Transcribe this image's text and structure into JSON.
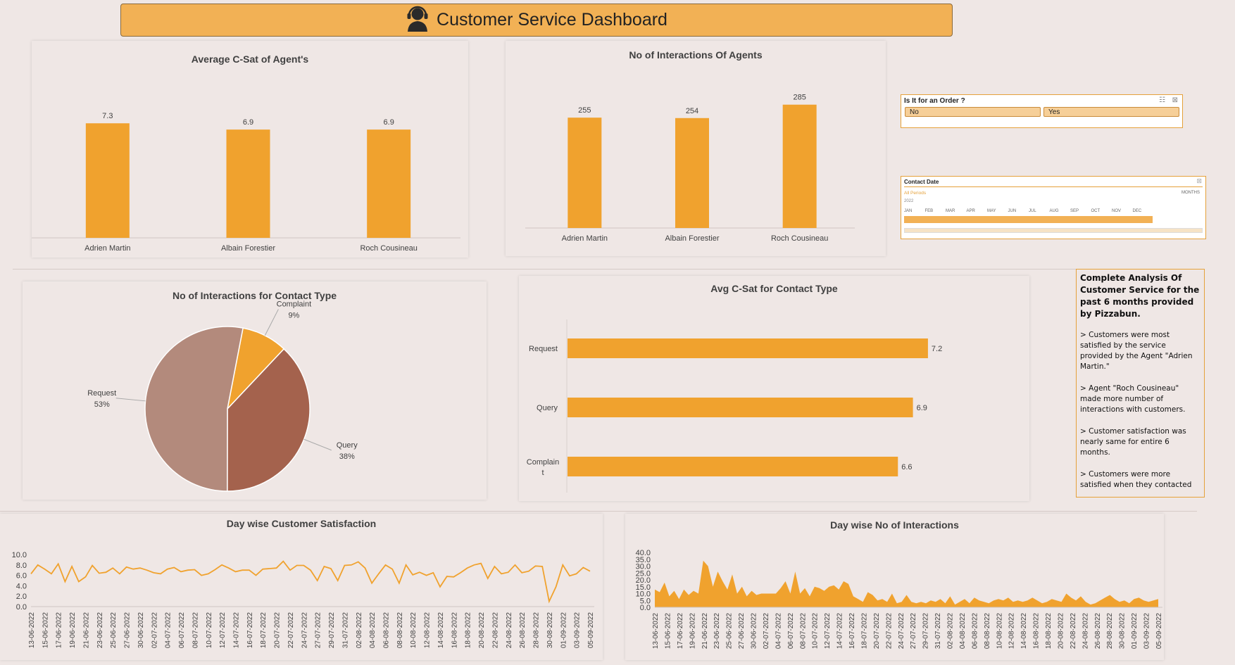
{
  "header": {
    "title": "Customer Service Dashboard",
    "icon": "headset-agent-icon"
  },
  "colors": {
    "accent": "#f0a22e",
    "header_bg": "#f2b155",
    "background": "#efe7e5",
    "pie_request": "#b38a7c",
    "pie_query": "#a4624d",
    "pie_complaint": "#f0a22e"
  },
  "slicer_order": {
    "title": "Is It for an Order ?",
    "options": [
      "No",
      "Yes"
    ]
  },
  "slicer_date": {
    "title": "Contact Date",
    "selection": "All Periods",
    "level": "MONTHS",
    "year": "2022",
    "months": [
      "JAN",
      "FEB",
      "MAR",
      "APR",
      "MAY",
      "JUN",
      "JUL",
      "AUG",
      "SEP",
      "OCT",
      "NOV",
      "DEC"
    ]
  },
  "analysis": {
    "heading": "Complete Analysis Of Customer Service for the past 6 months provided by Pizzabun.",
    "points": [
      "> Customers were most satisfied by the service provided by the Agent \"Adrien Martin.\"",
      "> Agent \"Roch Cousineau\" made more number of interactions with customers.",
      "> Customer satisfaction was nearly same  for entire 6 months.",
      "> Customers were more satisfied when they contacted"
    ]
  },
  "chart_data": [
    {
      "id": "csat_agent",
      "type": "bar",
      "title": "Average C-Sat of Agent's",
      "categories": [
        "Adrien Martin",
        "Albain Forestier",
        "Roch Cousineau"
      ],
      "values": [
        7.3,
        6.9,
        6.9
      ],
      "data_labels": [
        "7.3",
        "6.9",
        "6.9"
      ]
    },
    {
      "id": "interactions_agent",
      "type": "bar",
      "title": "No of Interactions Of Agents",
      "categories": [
        "Adrien Martin",
        "Albain Forestier",
        "Roch Cousineau"
      ],
      "values": [
        255,
        254,
        285
      ],
      "data_labels": [
        "255",
        "254",
        "285"
      ]
    },
    {
      "id": "interactions_contact_type",
      "type": "pie",
      "title": "No of Interactions for Contact Type",
      "categories": [
        "Complaint",
        "Query",
        "Request"
      ],
      "values": [
        9,
        38,
        53
      ],
      "data_labels": [
        "9%",
        "38%",
        "53%"
      ]
    },
    {
      "id": "csat_contact_type",
      "type": "bar",
      "orientation": "horizontal",
      "title": "Avg C-Sat for Contact Type",
      "categories": [
        "Request",
        "Query",
        "Complaint"
      ],
      "category_labels": [
        "Request",
        "Query",
        "Complain t"
      ],
      "values": [
        7.2,
        6.9,
        6.6
      ],
      "data_labels": [
        "7.2",
        "6.9",
        "6.6"
      ]
    },
    {
      "id": "daywise_csat",
      "type": "line",
      "title": "Day wise Customer Satisfaction",
      "ylim": [
        0,
        10
      ],
      "yticks": [
        "0.0",
        "2.0",
        "4.0",
        "6.0",
        "8.0",
        "10.0"
      ],
      "x": [
        "13-06-2022",
        "15-06-2022",
        "17-06-2022",
        "19-06-2022",
        "21-06-2022",
        "23-06-2022",
        "25-06-2022",
        "27-06-2022",
        "30-06-2022",
        "02-07-2022",
        "04-07-2022",
        "06-07-2022",
        "08-07-2022",
        "10-07-2022",
        "12-07-2022",
        "14-07-2022",
        "16-07-2022",
        "18-07-2022",
        "20-07-2022",
        "22-07-2022",
        "24-07-2022",
        "27-07-2022",
        "29-07-2022",
        "31-07-2022",
        "02-08-2022",
        "04-08-2022",
        "06-08-2022",
        "08-08-2022",
        "10-08-2022",
        "12-08-2022",
        "14-08-2022",
        "16-08-2022",
        "18-08-2022",
        "20-08-2022",
        "22-08-2022",
        "24-08-2022",
        "26-08-2022",
        "28-08-2022",
        "30-08-2022",
        "01-09-2022",
        "03-09-2022",
        "05-09-2022"
      ],
      "values": [
        6.3,
        8.0,
        7.2,
        6.3,
        8.2,
        4.8,
        7.7,
        4.8,
        5.7,
        7.9,
        6.4,
        6.6,
        7.4,
        6.3,
        7.6,
        7.2,
        7.4,
        7.0,
        6.5,
        6.3,
        7.2,
        7.5,
        6.7,
        7.0,
        7.1,
        6.0,
        6.3,
        7.1,
        8.0,
        7.4,
        6.7,
        7.0,
        7.0,
        6.0,
        7.2,
        7.3,
        7.4,
        8.7,
        7.0,
        7.9,
        7.9,
        7.0,
        5.0,
        7.7,
        7.3,
        5.0,
        7.9,
        8.0,
        8.6,
        7.4,
        4.5,
        6.3,
        8.0,
        7.2,
        4.5,
        8.0,
        6.1,
        6.6,
        6.0,
        6.5,
        3.8,
        5.8,
        5.7,
        6.5,
        7.4,
        8.0,
        8.3,
        5.4,
        7.7,
        6.3,
        6.6,
        8.0,
        6.5,
        6.8,
        7.8,
        7.7,
        1.0,
        3.8,
        8.0,
        5.9,
        6.3,
        7.5,
        6.8
      ]
    },
    {
      "id": "daywise_interactions",
      "type": "area",
      "title": "Day wise No of Interactions",
      "ylim": [
        0,
        40
      ],
      "yticks": [
        "0.0",
        "5.0",
        "10.0",
        "15.0",
        "20.0",
        "25.0",
        "30.0",
        "35.0",
        "40.0"
      ],
      "x": [
        "13-06-2022",
        "15-06-2022",
        "17-06-2022",
        "19-06-2022",
        "21-06-2022",
        "23-06-2022",
        "25-06-2022",
        "27-06-2022",
        "30-06-2022",
        "02-07-2022",
        "04-07-2022",
        "06-07-2022",
        "08-07-2022",
        "10-07-2022",
        "12-07-2022",
        "14-07-2022",
        "16-07-2022",
        "18-07-2022",
        "20-07-2022",
        "22-07-2022",
        "24-07-2022",
        "27-07-2022",
        "29-07-2022",
        "31-07-2022",
        "02-08-2022",
        "04-08-2022",
        "06-08-2022",
        "08-08-2022",
        "10-08-2022",
        "12-08-2022",
        "14-08-2022",
        "16-08-2022",
        "18-08-2022",
        "20-08-2022",
        "22-08-2022",
        "24-08-2022",
        "26-08-2022",
        "28-08-2022",
        "30-08-2022",
        "01-09-2022",
        "03-09-2022",
        "05-09-2022"
      ],
      "values": [
        13,
        11,
        18,
        8,
        12,
        6,
        13,
        9,
        12,
        10,
        34,
        30,
        15,
        26,
        19,
        13,
        24,
        10,
        15,
        8,
        12,
        9,
        10,
        10,
        10,
        10,
        14,
        19,
        10,
        26,
        10,
        14,
        8,
        15,
        14,
        12,
        15,
        16,
        13,
        19,
        17,
        8,
        6,
        4,
        11,
        9,
        5,
        6,
        4,
        10,
        3,
        4,
        9,
        4,
        3,
        4,
        3,
        5,
        4,
        6,
        3,
        8,
        2,
        4,
        6,
        3,
        7,
        5,
        4,
        3,
        5,
        6,
        5,
        7,
        4,
        5,
        4,
        5,
        7,
        5,
        3,
        4,
        6,
        5,
        4,
        10,
        7,
        5,
        8,
        4,
        2,
        3,
        5,
        7,
        9,
        6,
        4,
        5,
        3,
        6,
        7,
        5,
        4,
        5,
        6
      ]
    }
  ]
}
